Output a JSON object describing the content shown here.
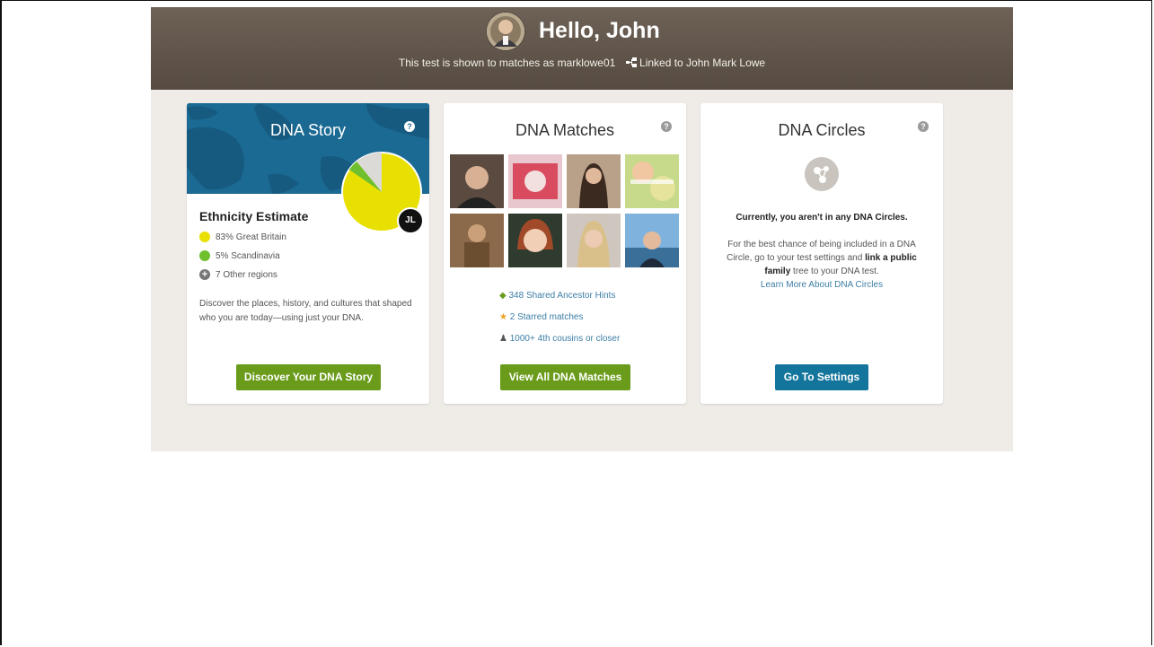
{
  "header": {
    "greeting": "Hello, John",
    "shown_as": "This test is shown to matches as marklowe01",
    "linked_to": "Linked to John Mark Lowe"
  },
  "colors": {
    "header_bg": "#5f5449",
    "panel_bg": "#efece8",
    "green_button": "#6a9b1b",
    "blue_button": "#13759b",
    "link": "#3d7ea6",
    "yellow": "#e8e000",
    "green": "#6fbf2f"
  },
  "dna_story": {
    "title": "DNA Story",
    "badge": "JL",
    "ethnicity_title": "Ethnicity Estimate",
    "regions": [
      {
        "label": "83% Great Britain",
        "percent": 83,
        "color": "#e8e000"
      },
      {
        "label": "5% Scandinavia",
        "percent": 5,
        "color": "#6fbf2f"
      },
      {
        "label": "7 Other regions",
        "icon": "plus-circle-icon"
      }
    ],
    "description": "Discover the places, history, and cultures that shaped who you are today—using just your DNA.",
    "button": "Discover Your DNA Story"
  },
  "dna_matches": {
    "title": "DNA Matches",
    "hints": [
      {
        "label": "348 Shared Ancestor Hints",
        "icon": "leaf-icon"
      },
      {
        "label": "2 Starred matches",
        "icon": "star-icon"
      },
      {
        "label": "1000+ 4th cousins or closer",
        "icon": "people-icon"
      }
    ],
    "button": "View All DNA Matches"
  },
  "dna_circles": {
    "title": "DNA Circles",
    "notice": "Currently, you aren't in any DNA Circles.",
    "text_1": "For the best chance of being included in a DNA Circle, go to your test settings and ",
    "text_bold": "link a public family",
    "text_2": " tree to your DNA test.",
    "learn_more": "Learn More About DNA Circles",
    "button": "Go To Settings"
  }
}
